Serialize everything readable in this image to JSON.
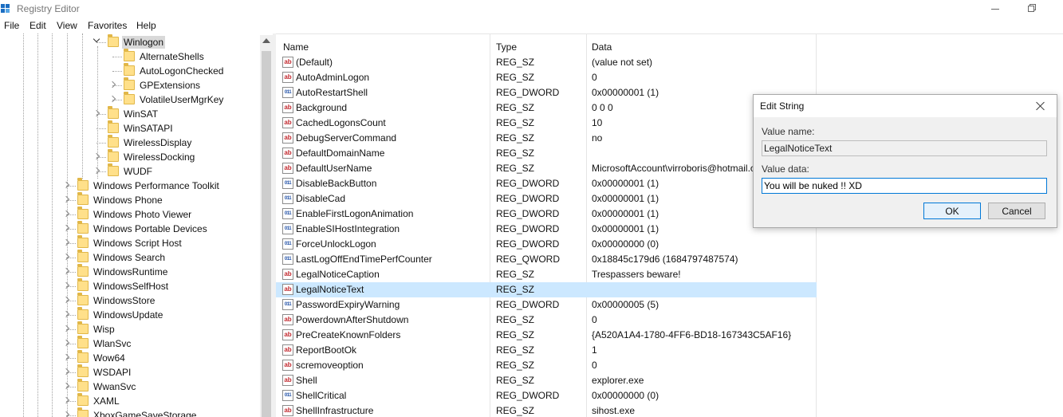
{
  "window": {
    "title": "Registry Editor"
  },
  "menu": [
    "File",
    "Edit",
    "View",
    "Favorites",
    "Help"
  ],
  "tree": {
    "items": [
      {
        "label": "Winlogon",
        "depth": 1,
        "expander": "expanded",
        "selected": true
      },
      {
        "label": "AlternateShells",
        "depth": 2,
        "expander": "none"
      },
      {
        "label": "AutoLogonChecked",
        "depth": 2,
        "expander": "none"
      },
      {
        "label": "GPExtensions",
        "depth": 2,
        "expander": "collapsed"
      },
      {
        "label": "VolatileUserMgrKey",
        "depth": 2,
        "expander": "collapsed"
      },
      {
        "label": "WinSAT",
        "depth": 1,
        "expander": "collapsed"
      },
      {
        "label": "WinSATAPI",
        "depth": 1,
        "expander": "none"
      },
      {
        "label": "WirelessDisplay",
        "depth": 1,
        "expander": "none"
      },
      {
        "label": "WirelessDocking",
        "depth": 1,
        "expander": "collapsed"
      },
      {
        "label": "WUDF",
        "depth": 1,
        "expander": "collapsed"
      },
      {
        "label": "Windows Performance Toolkit",
        "depth": 0,
        "expander": "collapsed"
      },
      {
        "label": "Windows Phone",
        "depth": 0,
        "expander": "collapsed"
      },
      {
        "label": "Windows Photo Viewer",
        "depth": 0,
        "expander": "collapsed"
      },
      {
        "label": "Windows Portable Devices",
        "depth": 0,
        "expander": "collapsed"
      },
      {
        "label": "Windows Script Host",
        "depth": 0,
        "expander": "collapsed"
      },
      {
        "label": "Windows Search",
        "depth": 0,
        "expander": "collapsed"
      },
      {
        "label": "WindowsRuntime",
        "depth": 0,
        "expander": "collapsed"
      },
      {
        "label": "WindowsSelfHost",
        "depth": 0,
        "expander": "collapsed"
      },
      {
        "label": "WindowsStore",
        "depth": 0,
        "expander": "collapsed"
      },
      {
        "label": "WindowsUpdate",
        "depth": 0,
        "expander": "collapsed"
      },
      {
        "label": "Wisp",
        "depth": 0,
        "expander": "collapsed"
      },
      {
        "label": "WlanSvc",
        "depth": 0,
        "expander": "collapsed"
      },
      {
        "label": "Wow64",
        "depth": 0,
        "expander": "collapsed"
      },
      {
        "label": "WSDAPI",
        "depth": 0,
        "expander": "collapsed"
      },
      {
        "label": "WwanSvc",
        "depth": 0,
        "expander": "collapsed"
      },
      {
        "label": "XAML",
        "depth": 0,
        "expander": "collapsed"
      },
      {
        "label": "XboxGameSaveStorage",
        "depth": 0,
        "expander": "collapsed"
      }
    ]
  },
  "list": {
    "columns": {
      "name": "Name",
      "type": "Type",
      "data": "Data"
    },
    "rows": [
      {
        "name": "(Default)",
        "type": "REG_SZ",
        "data": "(value not set)",
        "icon": "string-value-icon"
      },
      {
        "name": "AutoAdminLogon",
        "type": "REG_SZ",
        "data": "0",
        "icon": "string-value-icon"
      },
      {
        "name": "AutoRestartShell",
        "type": "REG_DWORD",
        "data": "0x00000001 (1)",
        "icon": "binary-value-icon"
      },
      {
        "name": "Background",
        "type": "REG_SZ",
        "data": "0 0 0",
        "icon": "string-value-icon"
      },
      {
        "name": "CachedLogonsCount",
        "type": "REG_SZ",
        "data": "10",
        "icon": "string-value-icon"
      },
      {
        "name": "DebugServerCommand",
        "type": "REG_SZ",
        "data": "no",
        "icon": "string-value-icon"
      },
      {
        "name": "DefaultDomainName",
        "type": "REG_SZ",
        "data": "",
        "icon": "string-value-icon"
      },
      {
        "name": "DefaultUserName",
        "type": "REG_SZ",
        "data": "MicrosoftAccount\\virroboris@hotmail.com",
        "icon": "string-value-icon"
      },
      {
        "name": "DisableBackButton",
        "type": "REG_DWORD",
        "data": "0x00000001 (1)",
        "icon": "binary-value-icon"
      },
      {
        "name": "DisableCad",
        "type": "REG_DWORD",
        "data": "0x00000001 (1)",
        "icon": "binary-value-icon"
      },
      {
        "name": "EnableFirstLogonAnimation",
        "type": "REG_DWORD",
        "data": "0x00000001 (1)",
        "icon": "binary-value-icon"
      },
      {
        "name": "EnableSIHostIntegration",
        "type": "REG_DWORD",
        "data": "0x00000001 (1)",
        "icon": "binary-value-icon"
      },
      {
        "name": "ForceUnlockLogon",
        "type": "REG_DWORD",
        "data": "0x00000000 (0)",
        "icon": "binary-value-icon"
      },
      {
        "name": "LastLogOffEndTimePerfCounter",
        "type": "REG_QWORD",
        "data": "0x18845c179d6 (1684797487574)",
        "icon": "binary-value-icon"
      },
      {
        "name": "LegalNoticeCaption",
        "type": "REG_SZ",
        "data": "Trespassers beware!",
        "icon": "string-value-icon"
      },
      {
        "name": "LegalNoticeText",
        "type": "REG_SZ",
        "data": "",
        "icon": "string-value-icon",
        "selected": true
      },
      {
        "name": "PasswordExpiryWarning",
        "type": "REG_DWORD",
        "data": "0x00000005 (5)",
        "icon": "binary-value-icon"
      },
      {
        "name": "PowerdownAfterShutdown",
        "type": "REG_SZ",
        "data": "0",
        "icon": "string-value-icon"
      },
      {
        "name": "PreCreateKnownFolders",
        "type": "REG_SZ",
        "data": "{A520A1A4-1780-4FF6-BD18-167343C5AF16}",
        "icon": "string-value-icon"
      },
      {
        "name": "ReportBootOk",
        "type": "REG_SZ",
        "data": "1",
        "icon": "string-value-icon"
      },
      {
        "name": "scremoveoption",
        "type": "REG_SZ",
        "data": "0",
        "icon": "string-value-icon"
      },
      {
        "name": "Shell",
        "type": "REG_SZ",
        "data": "explorer.exe",
        "icon": "string-value-icon"
      },
      {
        "name": "ShellCritical",
        "type": "REG_DWORD",
        "data": "0x00000000 (0)",
        "icon": "binary-value-icon"
      },
      {
        "name": "ShellInfrastructure",
        "type": "REG_SZ",
        "data": "sihost.exe",
        "icon": "string-value-icon"
      }
    ]
  },
  "dialog": {
    "title": "Edit String",
    "value_name_label": "Value name:",
    "value_name": "LegalNoticeText",
    "value_data_label": "Value data:",
    "value_data": "You will be nuked !! XD",
    "ok_label": "OK",
    "cancel_label": "Cancel"
  },
  "colors": {
    "selection": "#cce8ff",
    "accent": "#0078d7",
    "folder": "#ffe08a"
  }
}
